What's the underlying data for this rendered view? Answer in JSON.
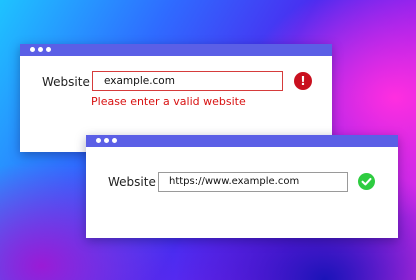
{
  "invalid_form": {
    "label": "Website",
    "value": "example.com",
    "status_icon": "error-exclamation-icon",
    "status_icon_text": "!",
    "error_message": "Please enter a valid website",
    "error_color": "#d81111"
  },
  "valid_form": {
    "label": "Website",
    "value": "https://www.example.com",
    "status_icon": "success-check-icon",
    "success_color": "#2ecc40"
  },
  "titlebar_color": "#5b5fe6"
}
